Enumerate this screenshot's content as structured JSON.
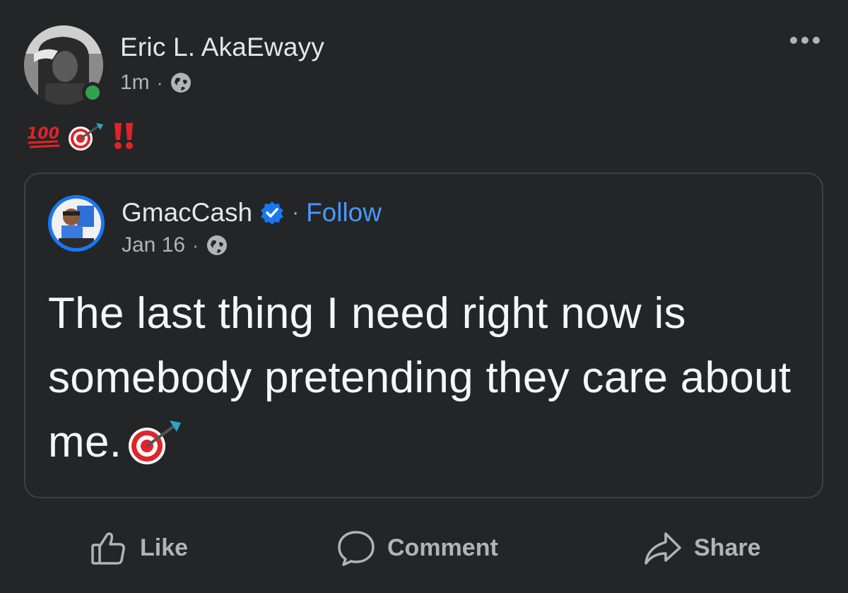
{
  "post": {
    "author": "Eric L. AkaEwayy",
    "time": "1m",
    "separator": "·",
    "privacy_icon": "globe-icon",
    "more_icon": "more-options-icon",
    "caption_emojis": [
      "hundred-points-emoji",
      "direct-hit-emoji",
      "double-exclamation-emoji"
    ]
  },
  "shared": {
    "author": "GmacCash",
    "verified_icon": "verified-badge-icon",
    "separator": "·",
    "follow_label": "Follow",
    "date": "Jan 16",
    "date_separator": "·",
    "privacy_icon": "globe-icon",
    "text": "The last thing I need right now is somebody pretending they care about me.",
    "text_emoji": "direct-hit-emoji"
  },
  "actions": {
    "like_label": "Like",
    "comment_label": "Comment",
    "share_label": "Share"
  },
  "colors": {
    "background": "#242526",
    "text_primary": "#e4e6eb",
    "text_secondary": "#b0b3b8",
    "link_blue": "#4599ff",
    "online_green": "#31a24c",
    "verified_blue": "#1877f2",
    "card_border": "#3e4042"
  }
}
